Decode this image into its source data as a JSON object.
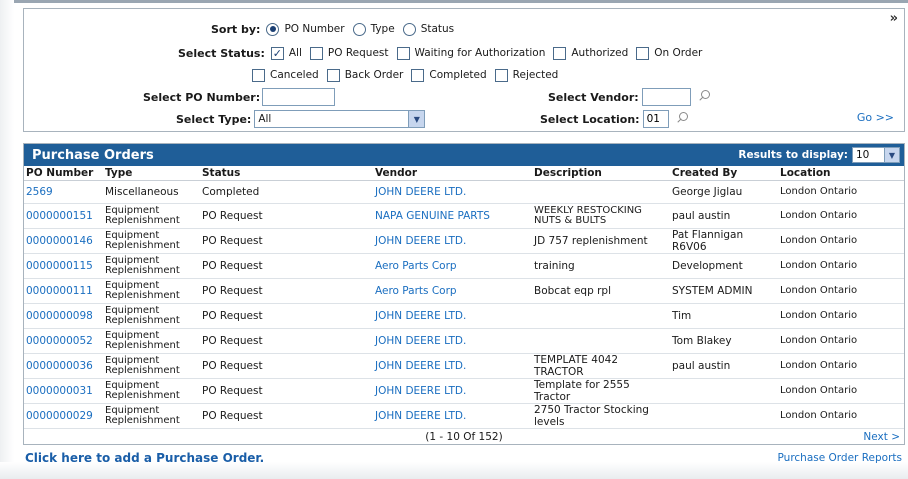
{
  "filters": {
    "sort_label": "Sort by:",
    "sort_options": [
      "PO Number",
      "Type",
      "Status"
    ],
    "sort_selected": 0,
    "status_label": "Select Status:",
    "status_row1": [
      "All",
      "PO Request",
      "Waiting for Authorization",
      "Authorized",
      "On Order"
    ],
    "status_row2": [
      "Canceled",
      "Back Order",
      "Completed",
      "Rejected"
    ],
    "status_checked": [
      "All"
    ],
    "po_number_label": "Select PO Number:",
    "po_number_value": "",
    "vendor_label": "Select Vendor:",
    "vendor_value": "",
    "type_label": "Select Type:",
    "type_value": "All",
    "location_label": "Select Location:",
    "location_value": "01",
    "go_label": "Go >>",
    "collapse_label": "»"
  },
  "results": {
    "title": "Purchase Orders",
    "display_label": "Results to display:",
    "display_value": "10",
    "columns": [
      "PO Number",
      "Type",
      "Status",
      "Vendor",
      "Description",
      "Created By",
      "Location"
    ],
    "rows": [
      [
        "2569",
        "Miscellaneous",
        "Completed",
        "JOHN DEERE LTD.",
        "",
        "George Jiglau",
        "London Ontario"
      ],
      [
        "0000000151",
        "Equipment Replenishment",
        "PO Request",
        "NAPA GENUINE PARTS",
        "WEEKLY RESTOCKING NUTS & BULTS",
        "paul austin",
        "London Ontario"
      ],
      [
        "0000000146",
        "Equipment Replenishment",
        "PO Request",
        "JOHN DEERE LTD.",
        "JD 757 replenishment",
        "Pat Flannigan R6V06",
        "London Ontario"
      ],
      [
        "0000000115",
        "Equipment Replenishment",
        "PO Request",
        "Aero Parts Corp",
        "training",
        "Development",
        "London Ontario"
      ],
      [
        "0000000111",
        "Equipment Replenishment",
        "PO Request",
        "Aero Parts Corp",
        "Bobcat eqp rpl",
        "SYSTEM ADMIN",
        "London Ontario"
      ],
      [
        "0000000098",
        "Equipment Replenishment",
        "PO Request",
        "JOHN DEERE LTD.",
        "",
        "Tim",
        "London Ontario"
      ],
      [
        "0000000052",
        "Equipment Replenishment",
        "PO Request",
        "JOHN DEERE LTD.",
        "",
        "Tom Blakey",
        "London Ontario"
      ],
      [
        "0000000036",
        "Equipment Replenishment",
        "PO Request",
        "JOHN DEERE LTD.",
        "TEMPLATE 4042 TRACTOR",
        "paul austin",
        "London Ontario"
      ],
      [
        "0000000031",
        "Equipment Replenishment",
        "PO Request",
        "JOHN DEERE LTD.",
        "Template for 2555 Tractor",
        "",
        "London Ontario"
      ],
      [
        "0000000029",
        "Equipment Replenishment",
        "PO Request",
        "JOHN DEERE LTD.",
        "2750 Tractor Stocking levels",
        "",
        "London Ontario"
      ]
    ],
    "pager_text": "(1 - 10 Of 152)",
    "next_label": "Next >"
  },
  "footer": {
    "add_link": "Click here to add a Purchase Order.",
    "reports_link": "Purchase Order Reports"
  },
  "colors": {
    "header_bar": "#1f5e98",
    "link": "#1a6ec0"
  }
}
